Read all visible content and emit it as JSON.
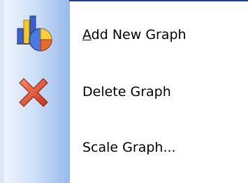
{
  "menu": {
    "items": [
      {
        "label_accel": "A",
        "label_rest": "dd New Graph",
        "icon": "chart-icon"
      },
      {
        "label": "Delete Graph",
        "icon": "delete-x-icon"
      },
      {
        "label": "Scale Graph..."
      }
    ]
  },
  "colors": {
    "gutter_light": "#eef4fd",
    "gutter_dark": "#98b9ec",
    "top_border": "#1c3f8f",
    "delete_red": "#e0432a",
    "text": "#000000"
  }
}
